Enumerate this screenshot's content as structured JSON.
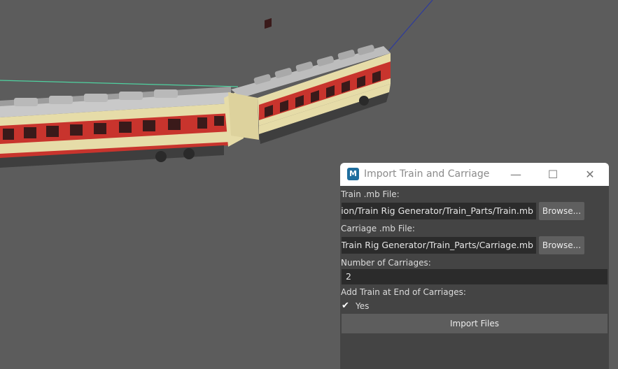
{
  "dialog": {
    "title": "Import Train and Carriage",
    "app_icon": "maya-icon",
    "window_controls": {
      "minimize": "—",
      "maximize": "☐",
      "close": "✕"
    },
    "train_label": "Train .mb File:",
    "train_path": "tion/Train Rig Generator/Train_Parts/Train.mb",
    "train_browse": "Browse...",
    "carriage_label": "Carriage .mb File:",
    "carriage_path": "\\Train Rig Generator/Train_Parts/Carriage.mb",
    "carriage_browse": "Browse...",
    "num_label": "Number of Carriages:",
    "num_value": "2",
    "add_train_label": "Add Train at End of Carriages:",
    "checkbox_mark": "✔",
    "checkbox_text": "Yes",
    "checkbox_checked": true,
    "import_label": "Import Files"
  },
  "colors": {
    "viewport": "#5c5c5c",
    "dialog_bg": "#444444",
    "field_bg": "#2b2b2b",
    "button_bg": "#5f5f5f",
    "train_body": "#e6dca8",
    "train_stripe": "#c8342d"
  }
}
